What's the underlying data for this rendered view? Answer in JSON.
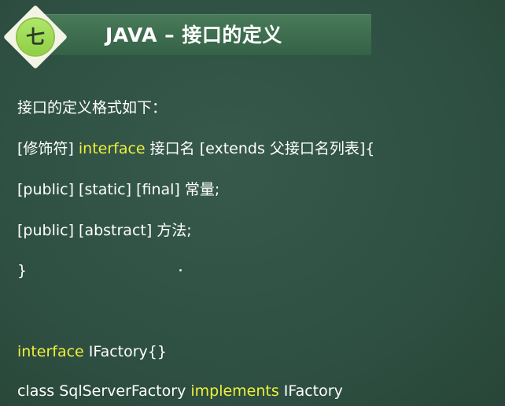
{
  "slide": {
    "number": "七",
    "title": "JAVA – 接口的定义"
  },
  "content": {
    "line1": "接口的定义格式如下：",
    "line2": {
      "prefix": "[修饰符] ",
      "keyword": "interface",
      "suffix": " 接口名 [extends 父接口名列表]{"
    },
    "line3": "[public] [static] [final] 常量;",
    "line4": "[public] [abstract] 方法;",
    "line5": "}",
    "line6": {
      "keyword": "interface",
      "suffix": " IFactory{}"
    },
    "line7": {
      "prefix": "class SqlServerFactory ",
      "keyword": "implements",
      "suffix": " IFactory"
    }
  },
  "colors": {
    "background": "#2f5144",
    "header_band": "#3e6e4f",
    "keyword": "#f0f03c",
    "badge_green": "#9ad955",
    "badge_frame": "#f4f4e6"
  }
}
